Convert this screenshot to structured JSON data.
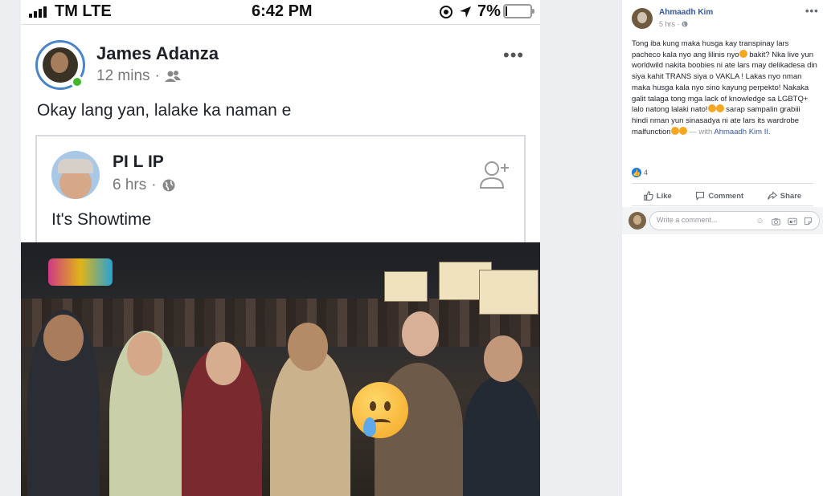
{
  "phone_status": {
    "carrier": "TM LTE",
    "time": "6:42 PM",
    "battery": "7%",
    "battery_level": 0.07,
    "icons": [
      "do-not-disturb-icon",
      "location-arrow-icon",
      "battery-icon",
      "signal-bars-icon"
    ]
  },
  "screenshot_post": {
    "author": "James Adanza",
    "time": "12 mins",
    "audience_icon": "friends-icon",
    "text": "Okay lang yan, lalake ka naman e",
    "more": "•••",
    "online": true
  },
  "shared_post": {
    "author": "PI L IP",
    "time": "6 hrs",
    "audience_icon": "globe-icon",
    "text": "It's Showtime",
    "action_icon": "add-friend-icon"
  },
  "video": {
    "overlay_emoji": "crying-face-emoji-icon",
    "description_colors": {
      "logo": "#e23b8d"
    }
  },
  "fb_post": {
    "author": "Ahmaadh Kim",
    "time": "5 hrs",
    "audience_icon": "globe-icon",
    "more": "•••",
    "text_parts": [
      "Tong iba kung maka husga kay transpinay lars pacheco kala nyo ang lilinis nyo",
      " bakit? Nka live yun worldwild nakita boobies ni ate lars may delikadesa din siya kahit TRANS siya o VAKLA ! Lakas nyo nman maka husga kala nyo sino kayung perpekto! Nakaka galit talaga tong mga lack of knowledge sa LGBTQ+ lalo natong lalaki nato!",
      " sarap sampalin grabiii hindi nman yun sinasadya ni ate lars its wardrobe malfunction",
      " — with "
    ],
    "tagged": "Ahmaadh Kim II.",
    "reaction_count": "4",
    "actions": {
      "like": "Like",
      "comment": "Comment",
      "share": "Share"
    },
    "comment_placeholder": "Write a comment...",
    "colors": {
      "link": "#385898",
      "like": "#1877f2"
    }
  }
}
